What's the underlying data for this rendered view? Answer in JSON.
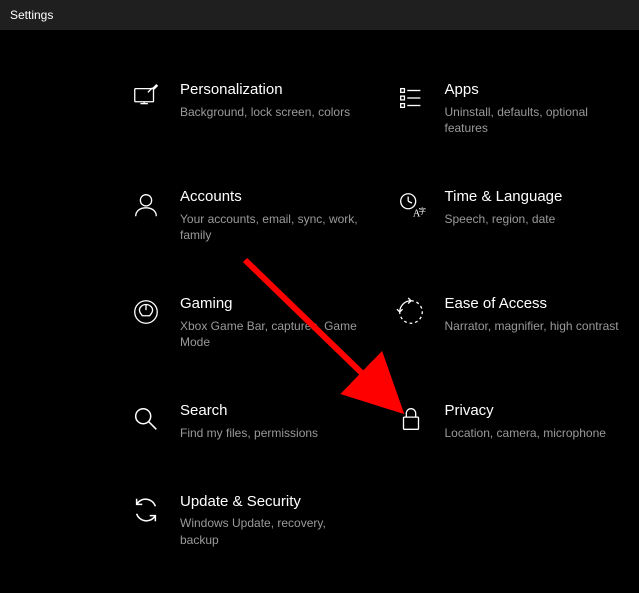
{
  "titlebar": {
    "title": "Settings"
  },
  "tiles": {
    "personalization": {
      "title": "Personalization",
      "subtitle": "Background, lock screen, colors"
    },
    "apps": {
      "title": "Apps",
      "subtitle": "Uninstall, defaults, optional features"
    },
    "accounts": {
      "title": "Accounts",
      "subtitle": "Your accounts, email, sync, work, family"
    },
    "time_language": {
      "title": "Time & Language",
      "subtitle": "Speech, region, date"
    },
    "gaming": {
      "title": "Gaming",
      "subtitle": "Xbox Game Bar, captures, Game Mode"
    },
    "ease_of_access": {
      "title": "Ease of Access",
      "subtitle": "Narrator, magnifier, high contrast"
    },
    "search": {
      "title": "Search",
      "subtitle": "Find my files, permissions"
    },
    "privacy": {
      "title": "Privacy",
      "subtitle": "Location, camera, microphone"
    },
    "update_security": {
      "title": "Update & Security",
      "subtitle": "Windows Update, recovery, backup"
    }
  },
  "annotation": {
    "arrow_color": "#ff0000"
  }
}
